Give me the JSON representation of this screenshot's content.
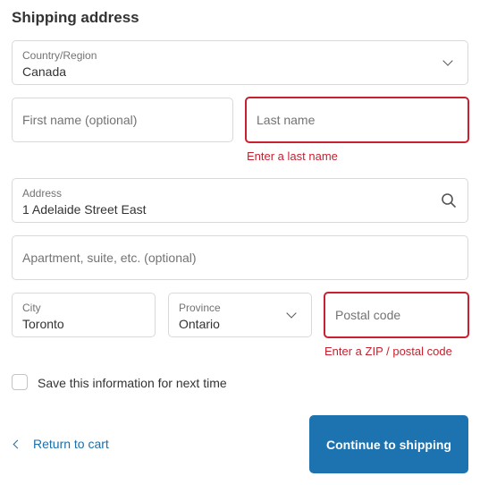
{
  "heading": "Shipping address",
  "country": {
    "label": "Country/Region",
    "value": "Canada"
  },
  "first_name": {
    "placeholder": "First name (optional)"
  },
  "last_name": {
    "placeholder": "Last name",
    "error": "Enter a last name"
  },
  "address": {
    "label": "Address",
    "value": "1 Adelaide Street East"
  },
  "apartment": {
    "placeholder": "Apartment, suite, etc. (optional)"
  },
  "city": {
    "label": "City",
    "value": "Toronto"
  },
  "province": {
    "label": "Province",
    "value": "Ontario"
  },
  "postal": {
    "placeholder": "Postal code",
    "error": "Enter a ZIP / postal code"
  },
  "save_info": {
    "label": "Save this information for next time",
    "checked": false
  },
  "actions": {
    "back_label": "Return to cart",
    "continue_label": "Continue to shipping"
  },
  "colors": {
    "error": "#c8202f",
    "link": "#1d6fa8",
    "primary": "#1c73b0",
    "border": "#d9d9d9"
  },
  "icons": {
    "country_dropdown": "chevron-down-icon",
    "address_search": "search-icon",
    "province_dropdown": "chevron-down-icon",
    "back": "chevron-left-icon"
  }
}
